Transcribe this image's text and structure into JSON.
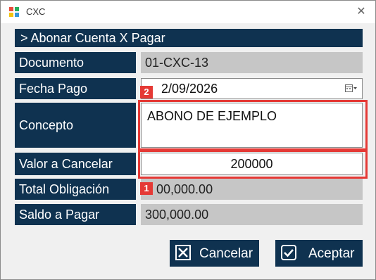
{
  "window": {
    "title": "CXC",
    "close_glyph": "✕"
  },
  "header": {
    "title": "> Abonar  Cuenta X Pagar"
  },
  "fields": {
    "documento": {
      "label": "Documento",
      "value": "01-CXC-13"
    },
    "fecha_pago": {
      "label": "Fecha Pago",
      "value": "2/09/2026"
    },
    "concepto": {
      "label": "Concepto",
      "value": "ABONO DE EJEMPLO"
    },
    "valor_cancelar": {
      "label": "Valor a Cancelar",
      "value": "200000"
    },
    "total_obligacion": {
      "label": "Total Obligación",
      "value": "00,000.00"
    },
    "saldo_pagar": {
      "label": "Saldo a Pagar",
      "value": "300,000.00"
    }
  },
  "annotations": [
    {
      "number": "1"
    },
    {
      "number": "2"
    }
  ],
  "buttons": {
    "cancel_label": "Cancelar",
    "accept_label": "Aceptar"
  },
  "colors": {
    "label_bg": "#0f3250",
    "readonly_bg": "#c6c6c6",
    "highlight": "#e53935"
  }
}
